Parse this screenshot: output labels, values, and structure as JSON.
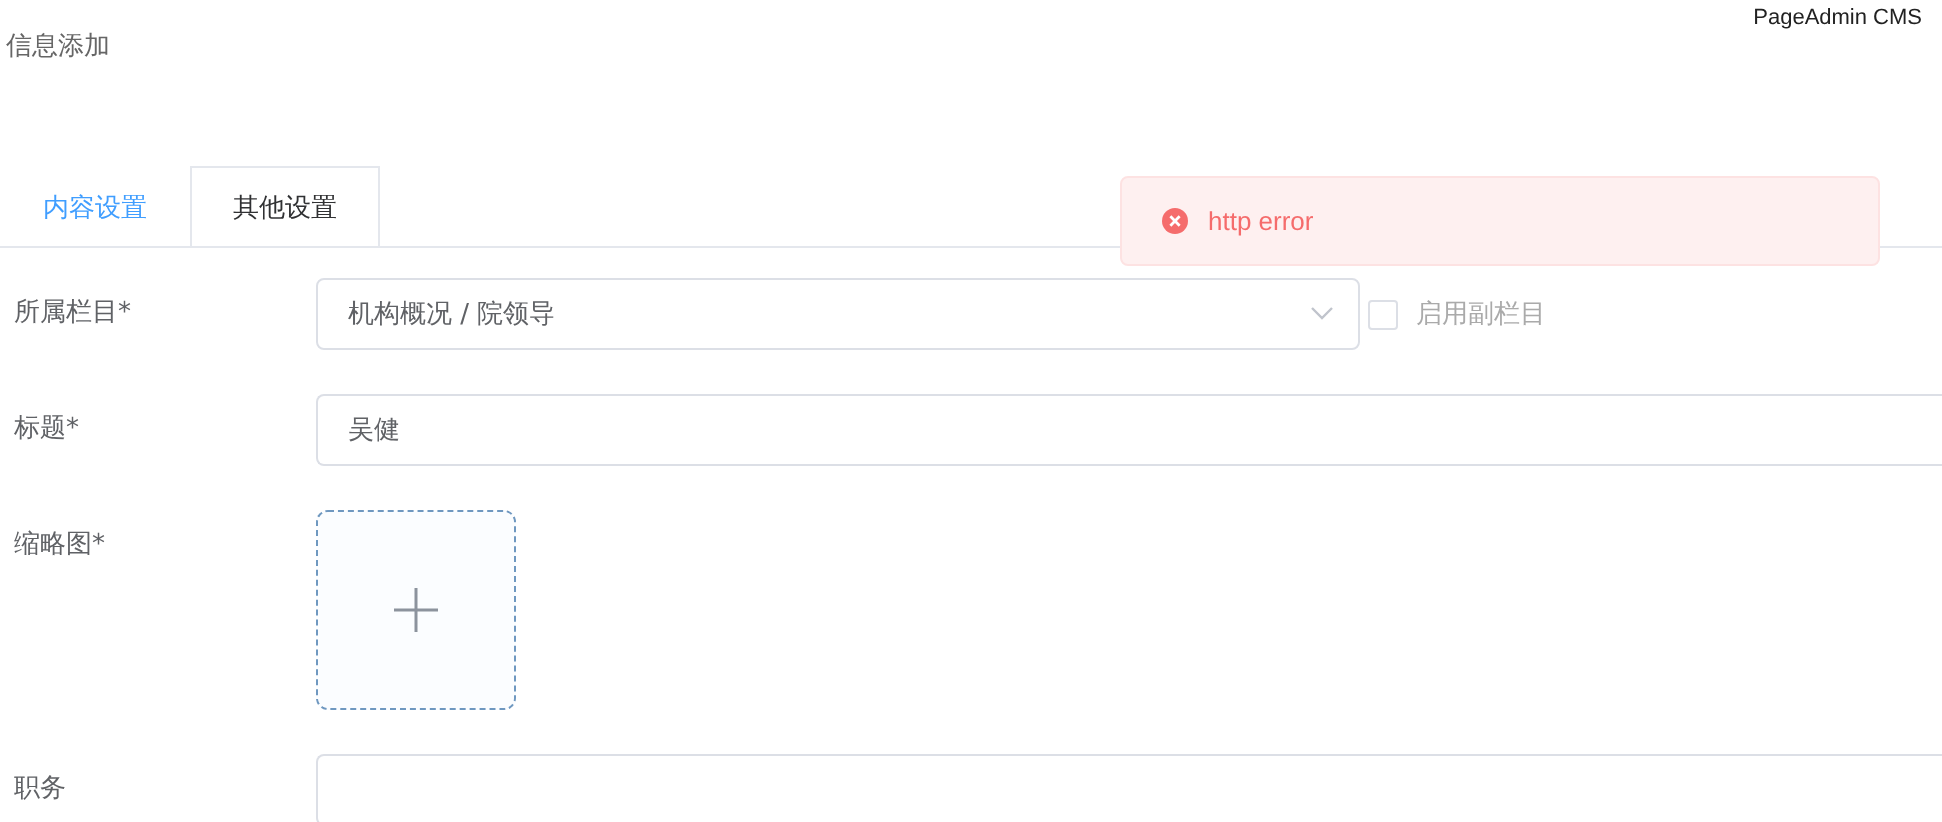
{
  "brand": "PageAdmin CMS",
  "page_title": "信息添加",
  "tabs": [
    {
      "label": "内容设置",
      "selected": true
    },
    {
      "label": "其他设置",
      "selected": false
    }
  ],
  "toast": {
    "kind": "error",
    "message": "http error"
  },
  "fields": [
    {
      "kind": "select",
      "label": "所属栏目*",
      "value": "机构概况 / 院领导",
      "option": {
        "label": "启用副栏目",
        "checked": false
      }
    },
    {
      "kind": "text",
      "label": "标题*",
      "value": "吴健"
    },
    {
      "kind": "upload",
      "label": "缩略图*"
    },
    {
      "kind": "text",
      "label": "职务"
    }
  ]
}
